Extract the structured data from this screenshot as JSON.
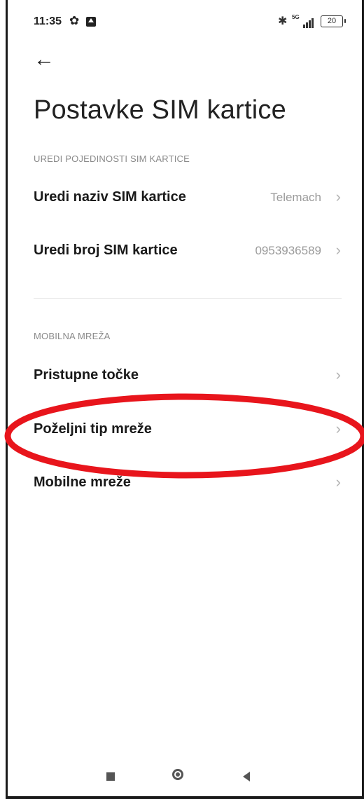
{
  "status_bar": {
    "time": "11:35",
    "battery": "20",
    "network": "5G",
    "icons": [
      "gear-icon",
      "app-notification-icon",
      "bluetooth-icon",
      "signal-icon",
      "battery-icon"
    ]
  },
  "nav": {
    "back_icon": "arrow-left-icon"
  },
  "page": {
    "title": "Postavke SIM kartice"
  },
  "sections": [
    {
      "header": "UREDI POJEDINOSTI SIM KARTICE",
      "items": [
        {
          "label": "Uredi naziv SIM kartice",
          "value": "Telemach"
        },
        {
          "label": "Uredi broj SIM kartice",
          "value": "0953936589"
        }
      ]
    },
    {
      "header": "MOBILNA MREŽA",
      "items": [
        {
          "label": "Pristupne točke",
          "value": ""
        },
        {
          "label": "Poželjni tip mreže",
          "value": ""
        },
        {
          "label": "Mobilne mreže",
          "value": ""
        }
      ]
    }
  ],
  "annotation": {
    "color": "#e8151c",
    "shape": "ellipse",
    "target": "Poželjni tip mreže"
  },
  "system_nav": {
    "buttons": [
      "recents-square-icon",
      "home-circle-icon",
      "back-triangle-icon"
    ]
  }
}
